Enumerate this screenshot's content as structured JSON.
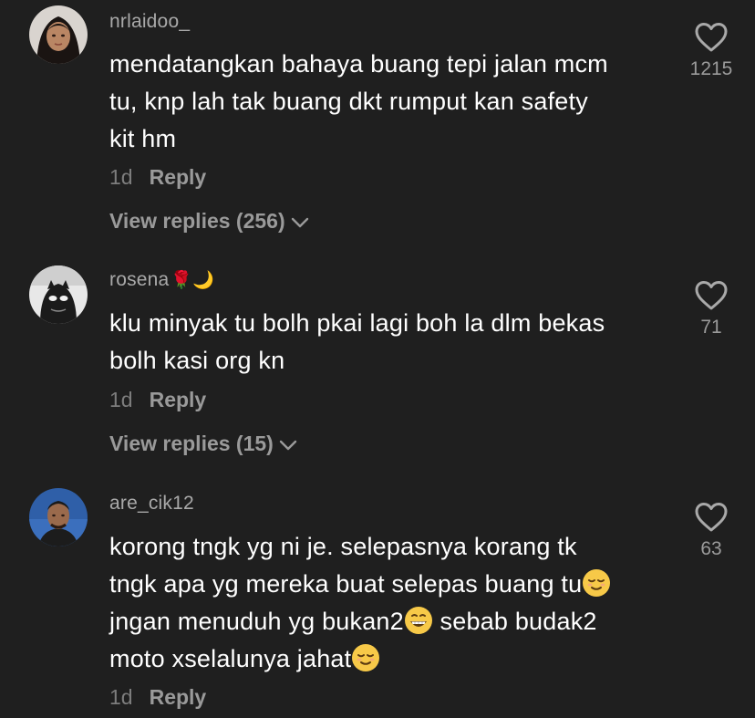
{
  "comments": [
    {
      "username": "nrlaidoo_",
      "text_lines": [
        "mendatangkan bahaya buang tepi jalan mcm",
        "tu, knp lah tak buang dkt rumput kan safety",
        "kit hm"
      ],
      "time": "1d",
      "reply_label": "Reply",
      "view_replies": "View replies (256)",
      "likes": "1215",
      "avatar_icon": "profile-photo-woman"
    },
    {
      "username": "rosena",
      "username_emoji": "🌹🌙",
      "text_lines": [
        "klu minyak tu bolh pkai lagi boh la dlm bekas",
        "bolh kasi org kn"
      ],
      "time": "1d",
      "reply_label": "Reply",
      "view_replies": "View replies (15)",
      "likes": "71",
      "avatar_icon": "profile-photo-masked"
    },
    {
      "username": "are_cik12",
      "text_lines": [
        "korong tngk yg ni je. selepasnya korang tk",
        "tngk apa yg mereka buat selepas buang tu",
        "jngan menuduh yg bukan2",
        " sebab budak2",
        "moto xselalunya jahat"
      ],
      "time": "1d",
      "reply_label": "Reply",
      "likes": "63",
      "avatar_icon": "profile-photo-man"
    }
  ],
  "colors": {
    "background": "#1f1f1f",
    "text": "#ffffff",
    "muted": "#9a9a9a"
  }
}
